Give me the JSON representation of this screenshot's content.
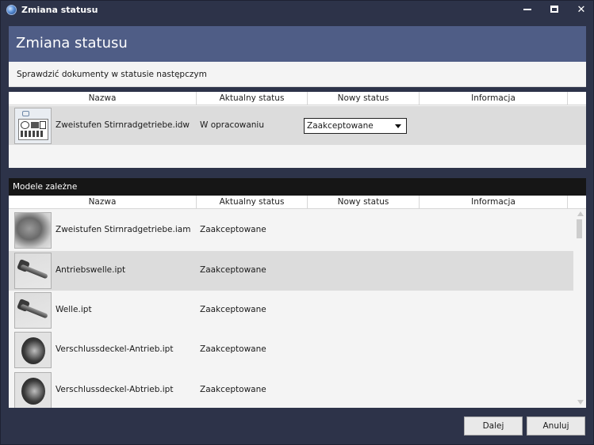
{
  "window": {
    "title": "Zmiana statusu",
    "minimize_icon": "minimize-icon",
    "maximize_icon": "maximize-icon",
    "close_icon": "close-icon",
    "close_glyph": "✕"
  },
  "header": {
    "title": "Zmiana statusu",
    "instruction": "Sprawdzić dokumenty w statusie następczym",
    "accent_color": "#4f5d86"
  },
  "columns": {
    "name": "Nazwa",
    "current_status": "Aktualny status",
    "new_status": "Nowy status",
    "info": "Informacja"
  },
  "documents": [
    {
      "name": "Zweistufen Stirnradgetriebe.idw",
      "current_status": "W opracowaniu",
      "new_status": "Zaakceptowane",
      "thumbnail": "drawing-thumbnail"
    }
  ],
  "dependent_models": {
    "title": "Modele zależne",
    "rows": [
      {
        "name": "Zweistufen Stirnradgetriebe.iam",
        "current_status": "Zaakceptowane",
        "thumbnail": "assembly-thumbnail"
      },
      {
        "name": "Antriebswelle.ipt",
        "current_status": "Zaakceptowane",
        "thumbnail": "shaft-thumbnail"
      },
      {
        "name": "Welle.ipt",
        "current_status": "Zaakceptowane",
        "thumbnail": "shaft-thumbnail"
      },
      {
        "name": "Verschlussdeckel-Antrieb.ipt",
        "current_status": "Zaakceptowane",
        "thumbnail": "cover-thumbnail"
      },
      {
        "name": "Verschlussdeckel-Abtrieb.ipt",
        "current_status": "Zaakceptowane",
        "thumbnail": "cover-thumbnail"
      }
    ]
  },
  "buttons": {
    "next": "Dalej",
    "cancel": "Anuluj"
  }
}
